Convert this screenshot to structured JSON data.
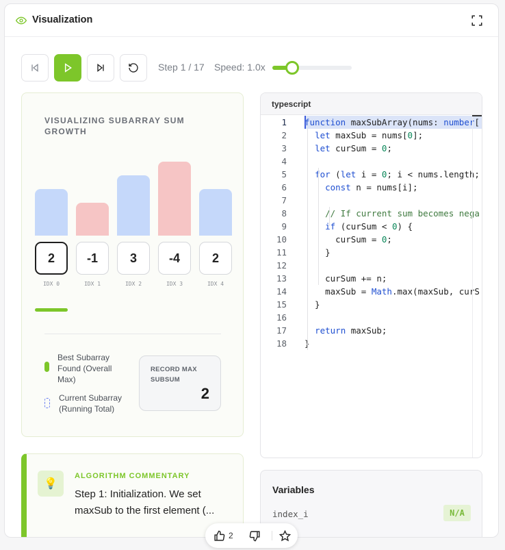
{
  "header": {
    "title": "Visualization",
    "eye_icon": "eye-icon",
    "fullscreen_icon": "fullscreen-icon"
  },
  "controls": {
    "step_text": "Step 1 / 17",
    "speed_text": "Speed: 1.0x",
    "speed_fraction": 0.25,
    "accent": "#7dc62a"
  },
  "viz": {
    "title": "VISUALIZING SUBARRAY SUM GROWTH",
    "array": [
      {
        "value": "2",
        "idx": "IDX 0",
        "sign": "pos",
        "active": true
      },
      {
        "value": "-1",
        "idx": "IDX 1",
        "sign": "neg",
        "active": false
      },
      {
        "value": "3",
        "idx": "IDX 2",
        "sign": "pos",
        "active": false
      },
      {
        "value": "-4",
        "idx": "IDX 3",
        "sign": "neg",
        "active": false
      },
      {
        "value": "2",
        "idx": "IDX 4",
        "sign": "pos",
        "active": false
      }
    ],
    "legend_best": "Best Subarray Found (Overall Max)",
    "legend_current": "Current Subarray (Running Total)",
    "record_label": "RECORD MAX SUBSUM",
    "record_value": "2"
  },
  "commentary": {
    "label": "ALGORITHM COMMENTARY",
    "text": "Step 1: Initialization. We set maxSub to the first element (..."
  },
  "code": {
    "language": "typescript",
    "current_line": 1,
    "lines": [
      "function maxSubArray(nums: number[",
      "  let maxSub = nums[0];",
      "  let curSum = 0;",
      "",
      "  for (let i = 0; i < nums.length;",
      "    const n = nums[i];",
      "",
      "    // If current sum becomes nega",
      "    if (curSum < 0) {",
      "      curSum = 0;",
      "    }",
      "",
      "    curSum += n;",
      "    maxSub = Math.max(maxSub, curS",
      "  }",
      "",
      "  return maxSub;",
      "}"
    ]
  },
  "variables": {
    "title": "Variables",
    "items": [
      {
        "name": "index_i",
        "value": "N/A"
      }
    ]
  },
  "feedback": {
    "likes": "2"
  }
}
